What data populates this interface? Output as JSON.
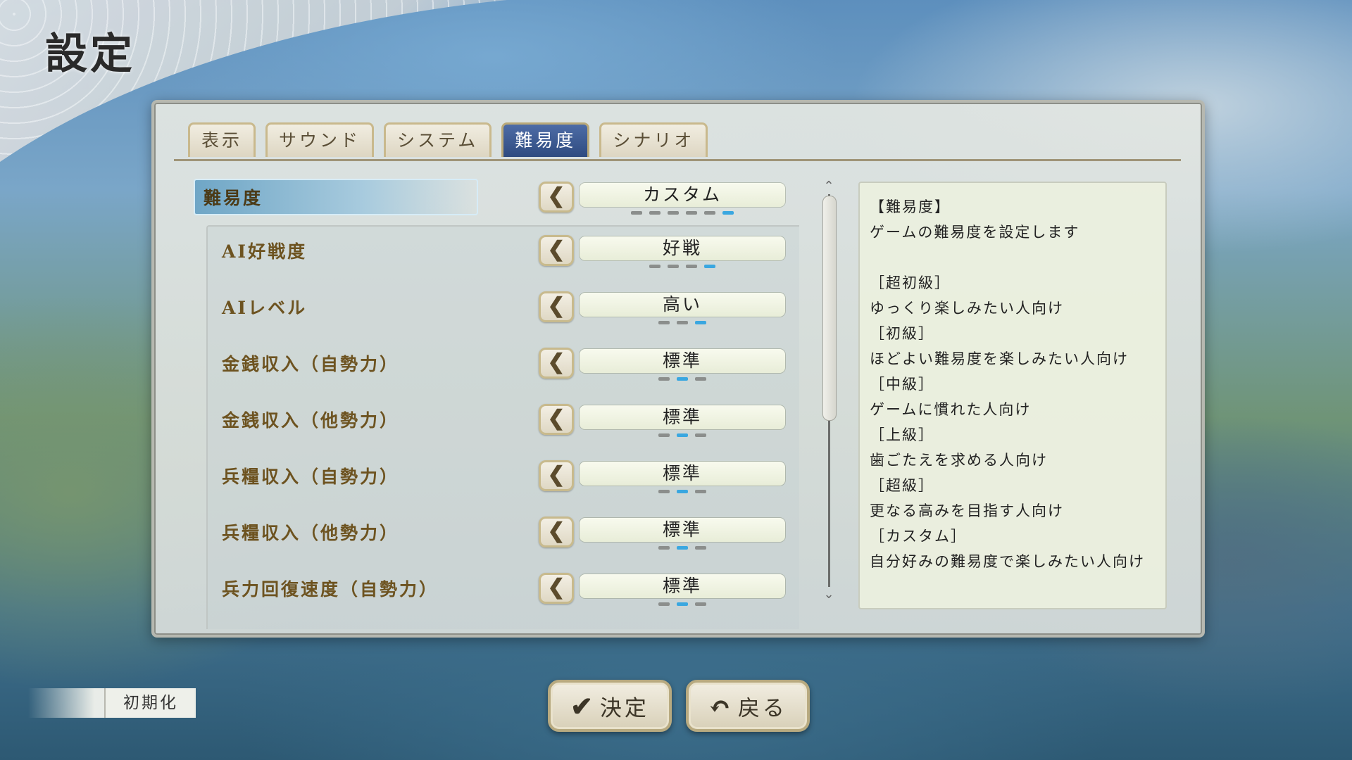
{
  "page": {
    "title": "設定"
  },
  "tabs": [
    {
      "label": "表示",
      "active": false
    },
    {
      "label": "サウンド",
      "active": false
    },
    {
      "label": "システム",
      "active": false
    },
    {
      "label": "難易度",
      "active": true
    },
    {
      "label": "シナリオ",
      "active": false
    }
  ],
  "settings": {
    "main": {
      "label": "難易度",
      "value": "カスタム",
      "options_count": 6,
      "selected_index": 5
    },
    "items": [
      {
        "label": "AI好戦度",
        "value": "好戦",
        "options_count": 4,
        "selected_index": 3
      },
      {
        "label": "AIレベル",
        "value": "高い",
        "options_count": 3,
        "selected_index": 2
      },
      {
        "label": "金銭収入（自勢力）",
        "value": "標準",
        "options_count": 3,
        "selected_index": 1
      },
      {
        "label": "金銭収入（他勢力）",
        "value": "標準",
        "options_count": 3,
        "selected_index": 1
      },
      {
        "label": "兵糧収入（自勢力）",
        "value": "標準",
        "options_count": 3,
        "selected_index": 1
      },
      {
        "label": "兵糧収入（他勢力）",
        "value": "標準",
        "options_count": 3,
        "selected_index": 1
      },
      {
        "label": "兵力回復速度（自勢力）",
        "value": "標準",
        "options_count": 3,
        "selected_index": 1
      }
    ],
    "arrow_left": "❮",
    "arrow_right": "❯"
  },
  "scroll": {
    "up": "⌃",
    "down": "⌄"
  },
  "description": [
    "【難易度】",
    "ゲームの難易度を設定します",
    "",
    "［超初級］",
    "ゆっくり楽しみたい人向け",
    "［初級］",
    "ほどよい難易度を楽しみたい人向け",
    "［中級］",
    "ゲームに慣れた人向け",
    "［上級］",
    "歯ごたえを求める人向け",
    "［超級］",
    "更なる高みを目指す人向け",
    "［カスタム］",
    "自分好みの難易度で楽しみたい人向け"
  ],
  "footer": {
    "reset_label": "初期化",
    "confirm_label": "決定",
    "back_label": "戻る",
    "confirm_icon": "✔",
    "back_icon": "↶"
  },
  "colors": {
    "accent": "#3aa7e0",
    "tab_active": "#3a5a94",
    "label": "#6d5320"
  }
}
